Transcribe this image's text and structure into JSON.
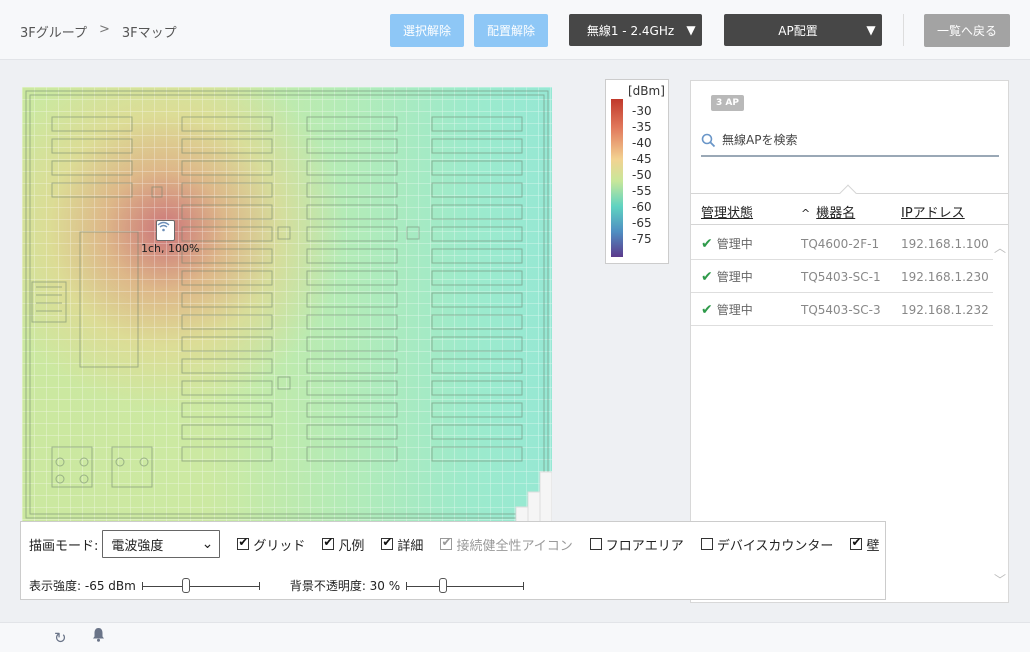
{
  "header": {
    "breadcrumb": [
      "3Fグループ",
      "3Fマップ"
    ],
    "breadcrumb_sep": ">",
    "btn_clear_selection": "選択解除",
    "btn_clear_placement": "配置解除",
    "radio_dropdown": "無線1 - 2.4GHz",
    "mode_dropdown": "AP配置",
    "btn_back_to_list": "一覧へ戻る",
    "caret": "▼"
  },
  "map": {
    "ap_label": "1ch, 100%"
  },
  "legend": {
    "title": "[dBm]",
    "ticks": [
      "-30",
      "-35",
      "-40",
      "-45",
      "-50",
      "-55",
      "-60",
      "-65",
      "-75"
    ]
  },
  "panel": {
    "ap_count": "3 AP",
    "search_placeholder": "無線APを検索",
    "columns": {
      "status": "管理状態",
      "name": "機器名",
      "ip": "IPアドレス"
    },
    "rows": [
      {
        "status": "管理中",
        "name": "TQ4600-2F-1",
        "ip": "192.168.1.100"
      },
      {
        "status": "管理中",
        "name": "TQ5403-SC-1",
        "ip": "192.168.1.230"
      },
      {
        "status": "管理中",
        "name": "TQ5403-SC-3",
        "ip": "192.168.1.232"
      }
    ]
  },
  "toolbar": {
    "draw_mode_label": "描画モード:",
    "draw_mode_value": "電波強度",
    "checkboxes": {
      "grid": {
        "label": "グリッド",
        "checked": true
      },
      "legend": {
        "label": "凡例",
        "checked": true
      },
      "detail": {
        "label": "詳細",
        "checked": true
      },
      "health": {
        "label": "接続健全性アイコン",
        "checked": true,
        "disabled": true
      },
      "floor_area": {
        "label": "フロアエリア",
        "checked": false
      },
      "device_counter": {
        "label": "デバイスカウンター",
        "checked": false
      },
      "wall": {
        "label": "壁",
        "checked": true
      }
    },
    "strength_label": "表示強度: -65 dBm",
    "strength_level": 0.36,
    "opacity_label": "背景不透明度: 30 %",
    "opacity_level": 0.3
  },
  "colors": {
    "accent_light_blue": "#8ec7f6",
    "dark_dropdown": "#474747",
    "status_green": "#2e9a4a"
  },
  "footer": {
    "icons": [
      "refresh-icon",
      "bell-icon"
    ]
  }
}
